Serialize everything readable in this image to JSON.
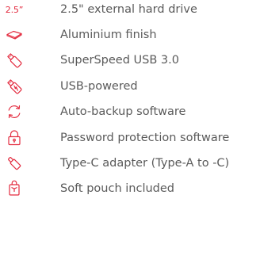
{
  "colors": {
    "icon_accent": "#e32b3f",
    "text": "#5a5a5a"
  },
  "features": [
    {
      "icon": "size-2-5-inch-icon",
      "icon_text": "2.5”",
      "label": "2.5\" external hard drive"
    },
    {
      "icon": "drive-shape-icon",
      "label": "Aluminium finish"
    },
    {
      "icon": "usb-stick-icon",
      "label": "SuperSpeed USB 3.0"
    },
    {
      "icon": "usb-power-icon",
      "label": "USB-powered"
    },
    {
      "icon": "sync-arrows-icon",
      "label": "Auto-backup software"
    },
    {
      "icon": "padlock-icon",
      "label": "Password protection software"
    },
    {
      "icon": "adapter-icon",
      "label": "Type-C adapter (Type-A to -C)"
    },
    {
      "icon": "pouch-icon",
      "label": "Soft pouch included"
    }
  ]
}
